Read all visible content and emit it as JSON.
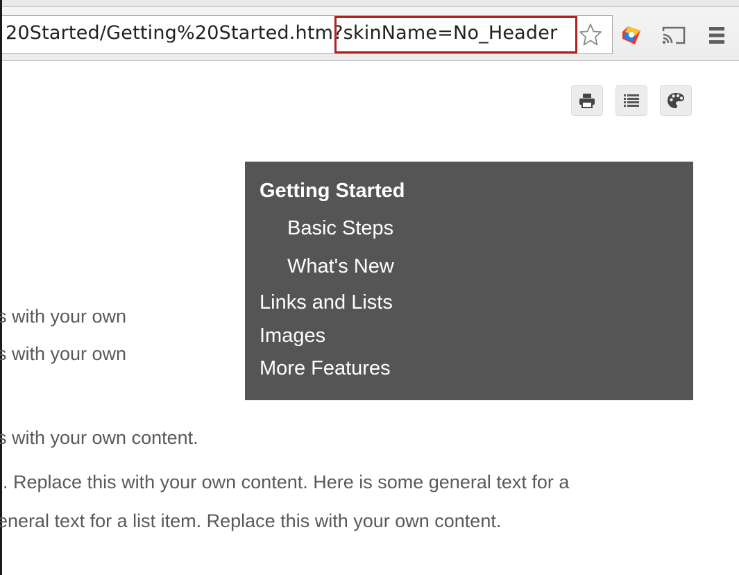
{
  "browser": {
    "url_visible": "20Started/Getting%20Started.htm",
    "url_query_highlighted": "?skinName=No_Header",
    "highlight_color": "#b2201f",
    "icons": [
      "star-icon",
      "extension-icon",
      "cast-icon",
      "menu-icon"
    ]
  },
  "page_toolbar": {
    "icons": [
      "print-icon",
      "toc-list-icon",
      "palette-icon"
    ]
  },
  "toc_menu": {
    "background": "#555555",
    "items": [
      {
        "label": "Getting Started"
      },
      {
        "label": "Basic Steps"
      },
      {
        "label": "What's New"
      },
      {
        "label": "Links and Lists"
      },
      {
        "label": "Images"
      },
      {
        "label": "More Features"
      }
    ]
  },
  "content": {
    "lines": [
      "s with your own",
      "s with your own",
      "s with your own content.",
      ". Replace this with your own content. Here is some general text for a",
      "eneral text for a list item. Replace this with your own content."
    ]
  }
}
